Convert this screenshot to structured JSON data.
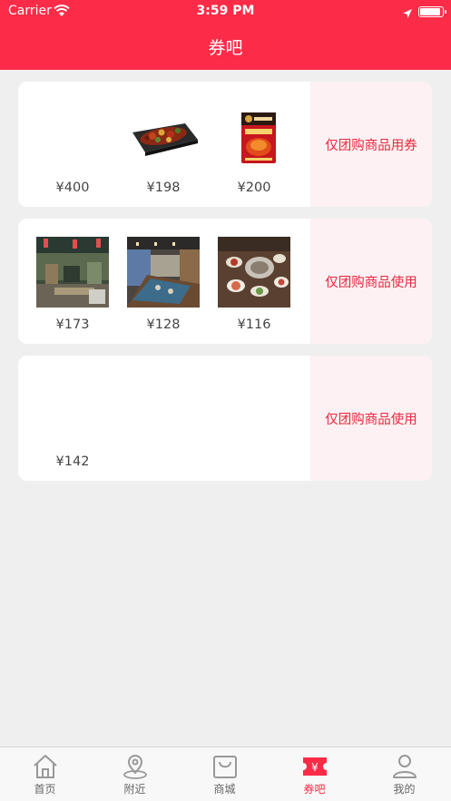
{
  "status_bar": {
    "carrier": "Carrier",
    "time": "3:59 PM"
  },
  "header": {
    "title": "券吧"
  },
  "coupons": [
    {
      "note": "仅团购商品用券",
      "items": [
        {
          "price": "¥400",
          "image": "none"
        },
        {
          "price": "¥198",
          "image": "grill-pan-food"
        },
        {
          "price": "¥200",
          "image": "hotpot-seasoning-pack"
        }
      ]
    },
    {
      "note": "仅团购商品使用",
      "items": [
        {
          "price": "¥173",
          "image": "restaurant-interior"
        },
        {
          "price": "¥128",
          "image": "restaurant-dining-room"
        },
        {
          "price": "¥116",
          "image": "hotpot-table-spread"
        }
      ]
    },
    {
      "note": "仅团购商品使用",
      "items": [
        {
          "price": "¥142",
          "image": "none"
        }
      ]
    }
  ],
  "tabbar": {
    "tabs": [
      {
        "label": "首页",
        "icon": "home-icon"
      },
      {
        "label": "附近",
        "icon": "location-pin-icon"
      },
      {
        "label": "商城",
        "icon": "shopping-bag-icon"
      },
      {
        "label": "券吧",
        "icon": "coupon-ticket-icon"
      },
      {
        "label": "我的",
        "icon": "user-icon"
      }
    ],
    "active_index": 3
  },
  "colors": {
    "brand": "#fc2b47",
    "note_text": "#e8283e",
    "note_bg": "#fdf1f3",
    "page_bg": "#efefef"
  }
}
